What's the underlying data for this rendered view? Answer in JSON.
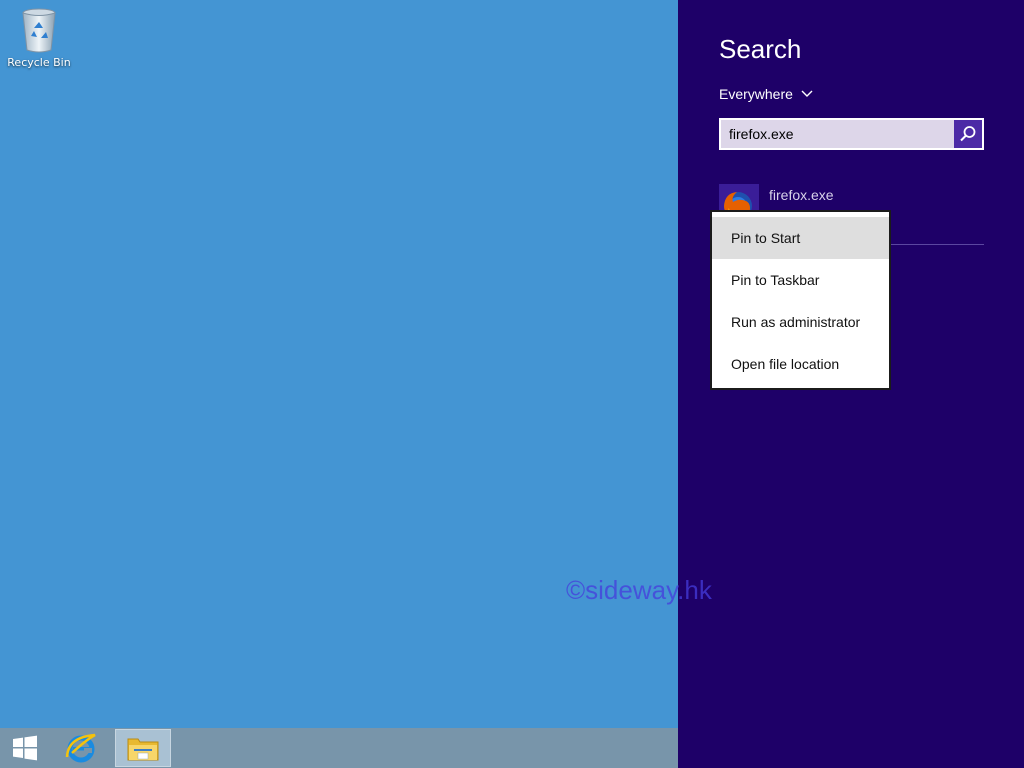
{
  "desktop": {
    "recycle_bin_label": "Recycle Bin"
  },
  "taskbar": {
    "items": [
      {
        "name": "start",
        "icon": "windows-logo-icon"
      },
      {
        "name": "internet-explorer",
        "icon": "internet-explorer-icon"
      },
      {
        "name": "file-explorer",
        "icon": "folder-icon",
        "active": true
      }
    ]
  },
  "charm": {
    "title": "Search",
    "scope": "Everywhere",
    "search_value": "firefox.exe",
    "results": [
      {
        "label": "firefox.exe",
        "icon": "firefox-icon"
      }
    ]
  },
  "context_menu": {
    "items": [
      {
        "label": "Pin to Start",
        "highlighted": true
      },
      {
        "label": "Pin to Taskbar"
      },
      {
        "label": "Run as administrator"
      },
      {
        "label": "Open file location"
      }
    ]
  },
  "watermark": "©sideway.hk",
  "colors": {
    "desktop": "#4495d3",
    "charm_bg": "#1e0068",
    "taskbar": "#7895aa",
    "search_button": "#4c2aa6"
  }
}
